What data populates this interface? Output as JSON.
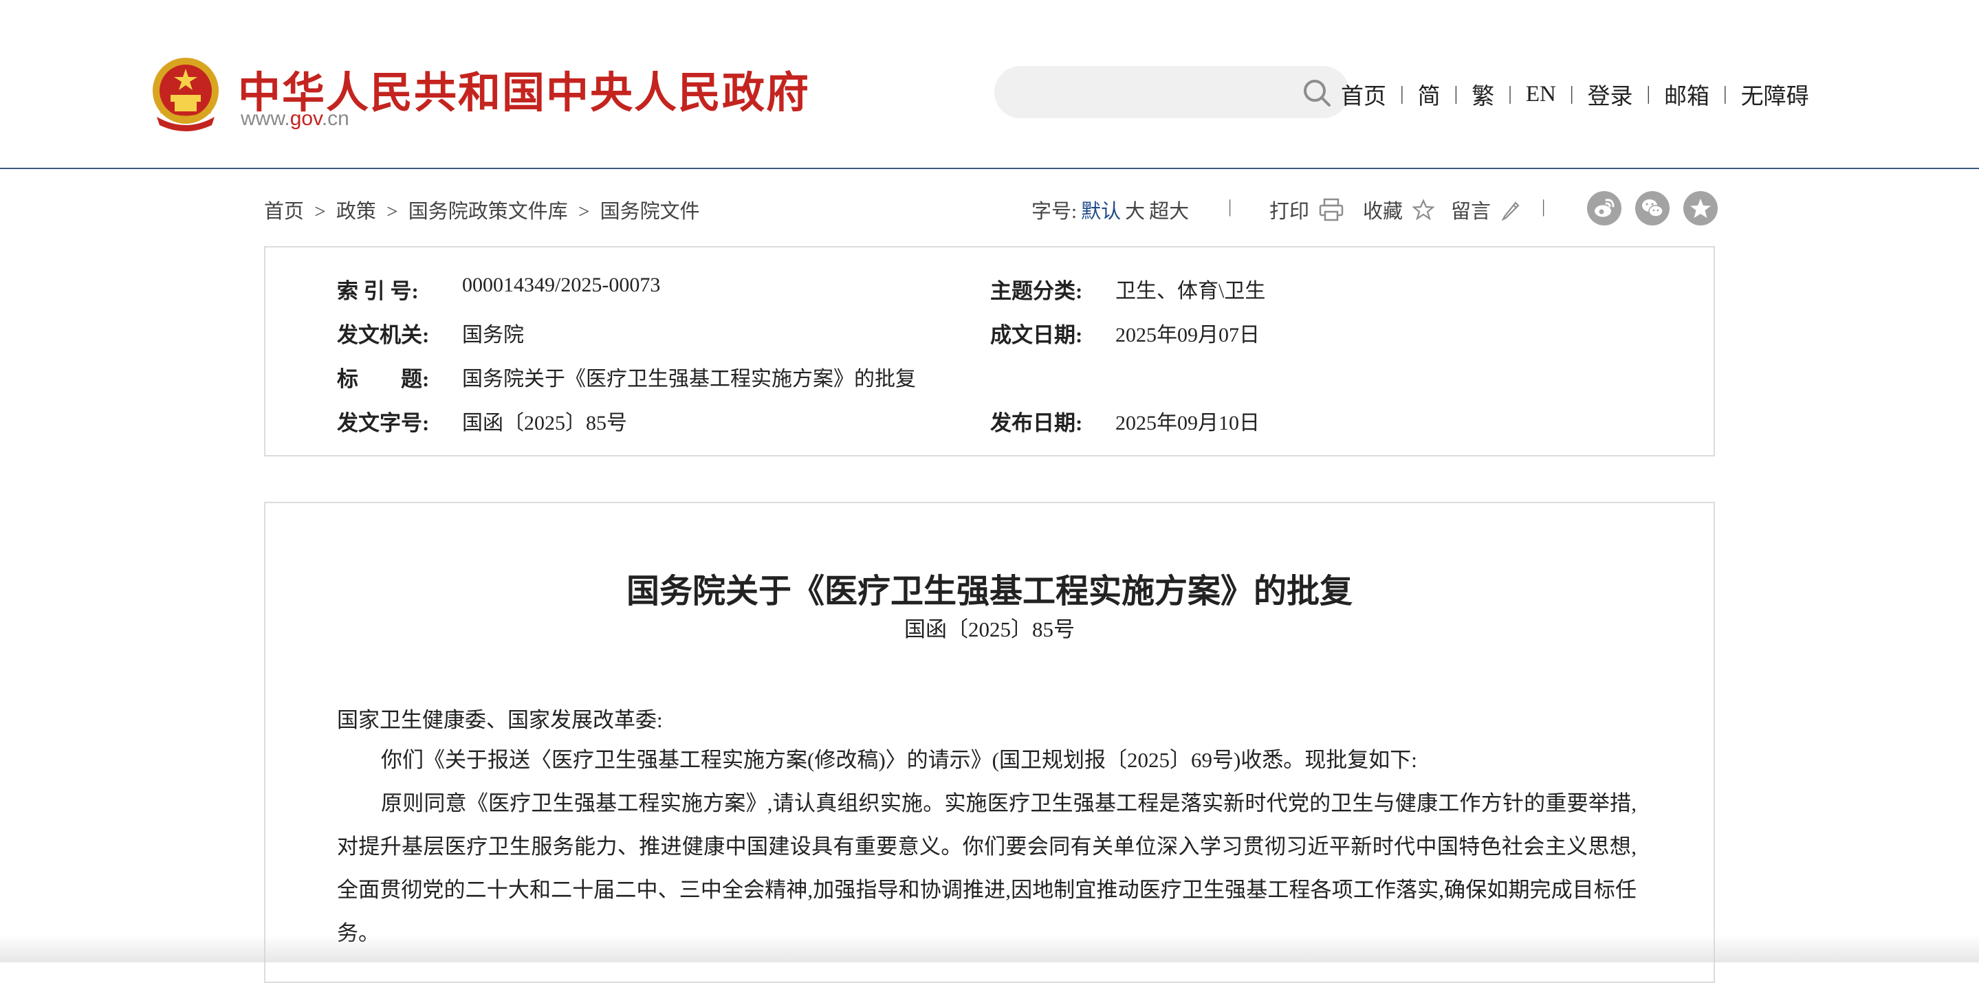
{
  "header": {
    "site_name": "中华人民共和国中央人民政府",
    "site_url_prefix": "www.",
    "site_url_domain": "gov",
    "site_url_suffix": ".cn",
    "search_placeholder": "",
    "nav": [
      {
        "label": "首页"
      },
      {
        "label": "简"
      },
      {
        "label": "繁"
      },
      {
        "label": "EN"
      },
      {
        "label": "登录"
      },
      {
        "label": "邮箱"
      },
      {
        "label": "无障碍"
      }
    ],
    "nav_separator": "|"
  },
  "breadcrumb": {
    "items": [
      "首页",
      "政策",
      "国务院政策文件库",
      "国务院文件"
    ],
    "separator": ">"
  },
  "toolbar": {
    "font_size_label": "字号:",
    "font_sizes": [
      "默认",
      "大",
      "超大"
    ],
    "active_font_size": "默认",
    "separator": "|",
    "print_label": "打印",
    "favorite_label": "收藏",
    "comment_label": "留言",
    "share_icons": [
      "weibo-icon",
      "wechat-icon",
      "star-badge-icon"
    ]
  },
  "meta": {
    "index_no_label": "索 引 号:",
    "index_no": "000014349/2025-00073",
    "category_label": "主题分类:",
    "category": "卫生、体育\\卫生",
    "issuer_label": "发文机关:",
    "issuer": "国务院",
    "written_date_label": "成文日期:",
    "written_date": "2025年09月07日",
    "title_label": "标　　题:",
    "title": "国务院关于《医疗卫生强基工程实施方案》的批复",
    "doc_no_label": "发文字号:",
    "doc_no": "国函〔2025〕85号",
    "publish_date_label": "发布日期:",
    "publish_date": "2025年09月10日"
  },
  "article": {
    "title": "国务院关于《医疗卫生强基工程实施方案》的批复",
    "doc_no": "国函〔2025〕85号",
    "addressee": "国家卫生健康委、国家发展改革委:",
    "paragraphs": [
      "你们《关于报送〈医疗卫生强基工程实施方案(修改稿)〉的请示》(国卫规划报〔2025〕69号)收悉。现批复如下:",
      "原则同意《医疗卫生强基工程实施方案》,请认真组织实施。实施医疗卫生强基工程是落实新时代党的卫生与健康工作方针的重要举措,对提升基层医疗卫生服务能力、推进健康中国建设具有重要意义。你们要会同有关单位深入学习贯彻习近平新时代中国特色社会主义思想,全面贯彻党的二十大和二十届二中、三中全会精神,加强指导和协调推进,因地制宜推动医疗卫生强基工程各项工作落实,确保如期完成目标任务。"
    ]
  },
  "colors": {
    "brand_red": "#c4241f",
    "header_rule": "#3b5a80",
    "active_link": "#1f4a8a",
    "panel_border": "#dcdcdc",
    "share_icon_bg": "#a3a3a3"
  }
}
